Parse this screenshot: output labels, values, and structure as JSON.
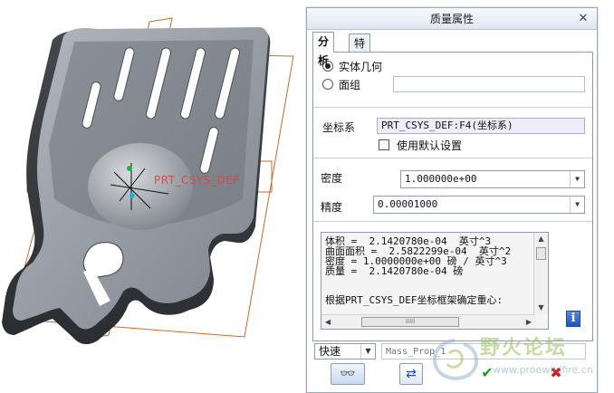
{
  "viewport": {
    "csys_label": "PRT_CSYS_DEF",
    "model_color": "#8f9399",
    "datum_color": "#c96a2a"
  },
  "dialog": {
    "title": "质量属性",
    "close_glyph": "✕",
    "tabs": [
      {
        "label": "分析",
        "active": true
      },
      {
        "label": "特征",
        "active": false
      }
    ],
    "options": {
      "solid_geometry": "实体几何",
      "quilt": "面组",
      "selected": "实体几何"
    },
    "csys": {
      "label": "坐标系",
      "value": "PRT_CSYS_DEF:F4(坐标系)",
      "use_default_label": "使用默认设置",
      "use_default_checked": false
    },
    "density": {
      "label": "密度",
      "value": "1.000000e+00"
    },
    "accuracy": {
      "label": "精度",
      "value": "0.00001000"
    },
    "results": {
      "line1": "体积 =  2.1420780e-04  英寸^3",
      "line2": "曲面面积 =  2.5822299e-04  英寸^2",
      "line3": "密度 = 1.0000000e+00 磅 / 英寸^3",
      "line4": "质量 =  2.1420780e-04 磅",
      "note": "根据PRT_CSYS_DEF坐标框架确定重心:",
      "hscroll_grip": "IIIII"
    },
    "info_button": "i",
    "mode": {
      "value": "快速"
    },
    "name_field": {
      "placeholder": "Mass_Prop_1"
    },
    "buttons": {
      "preview_glyph": "👓",
      "repeat_glyph": "⇄",
      "ok_glyph": "✔",
      "cancel_glyph": "✖"
    }
  },
  "watermark": {
    "text": "野火论坛",
    "url": "www.proewildfire.cn"
  }
}
